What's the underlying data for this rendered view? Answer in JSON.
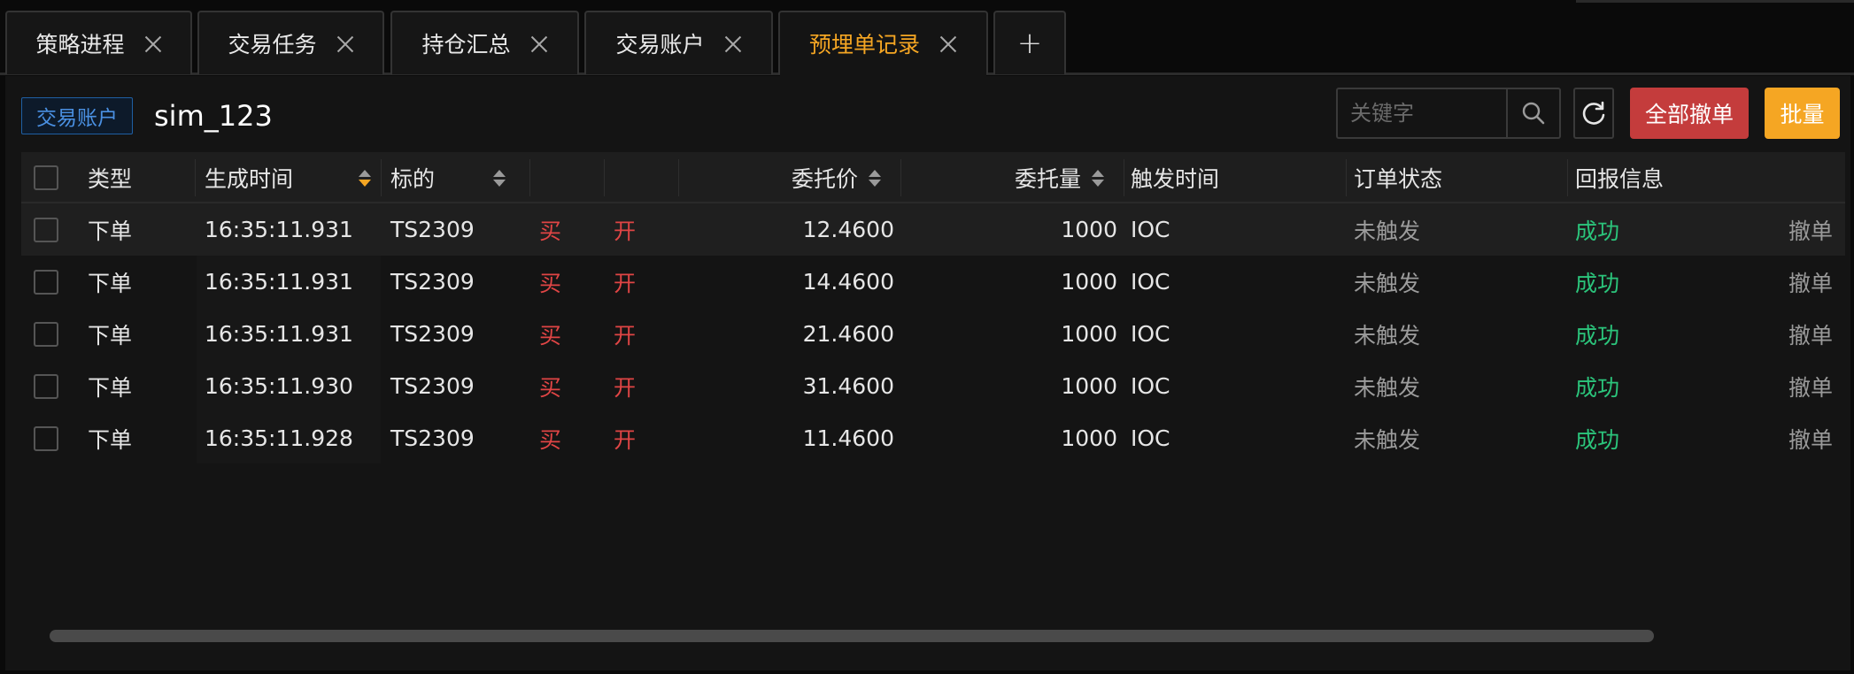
{
  "tabs": [
    {
      "label": "策略进程",
      "closable": true,
      "active": false
    },
    {
      "label": "交易任务",
      "closable": true,
      "active": false
    },
    {
      "label": "持仓汇总",
      "closable": true,
      "active": false
    },
    {
      "label": "交易账户",
      "closable": true,
      "active": false
    },
    {
      "label": "预埋单记录",
      "closable": true,
      "active": true
    }
  ],
  "add_tab_label": "+",
  "toolbar": {
    "account_badge": "交易账户",
    "account_name": "sim_123",
    "search_placeholder": "关键字",
    "search_icon": "search-icon",
    "refresh_icon": "refresh-icon",
    "cancel_all_label": "全部撤单",
    "batch_label": "批量"
  },
  "table": {
    "headers": {
      "type": "类型",
      "time": "生成时间",
      "symbol": "标的",
      "price": "委托价",
      "qty": "委托量",
      "trigger": "触发时间",
      "status": "订单状态",
      "report": "回报信息"
    },
    "sort_active_column": "time",
    "rows": [
      {
        "type": "下单",
        "time": "16:35:11.931",
        "symbol": "TS2309",
        "side": "买",
        "offset": "开",
        "price": "12.4600",
        "qty": "1000",
        "trigger": "IOC",
        "status": "未触发",
        "report": "成功",
        "action": "撤单"
      },
      {
        "type": "下单",
        "time": "16:35:11.931",
        "symbol": "TS2309",
        "side": "买",
        "offset": "开",
        "price": "14.4600",
        "qty": "1000",
        "trigger": "IOC",
        "status": "未触发",
        "report": "成功",
        "action": "撤单"
      },
      {
        "type": "下单",
        "time": "16:35:11.931",
        "symbol": "TS2309",
        "side": "买",
        "offset": "开",
        "price": "21.4600",
        "qty": "1000",
        "trigger": "IOC",
        "status": "未触发",
        "report": "成功",
        "action": "撤单"
      },
      {
        "type": "下单",
        "time": "16:35:11.930",
        "symbol": "TS2309",
        "side": "买",
        "offset": "开",
        "price": "31.4600",
        "qty": "1000",
        "trigger": "IOC",
        "status": "未触发",
        "report": "成功",
        "action": "撤单"
      },
      {
        "type": "下单",
        "time": "16:35:11.928",
        "symbol": "TS2309",
        "side": "买",
        "offset": "开",
        "price": "11.4600",
        "qty": "1000",
        "trigger": "IOC",
        "status": "未触发",
        "report": "成功",
        "action": "撤单"
      }
    ]
  },
  "colors": {
    "accent": "#f5a623",
    "danger": "#c43c3c",
    "buy": "#e04545",
    "success": "#2bc47b",
    "badge": "#4a90e2"
  }
}
